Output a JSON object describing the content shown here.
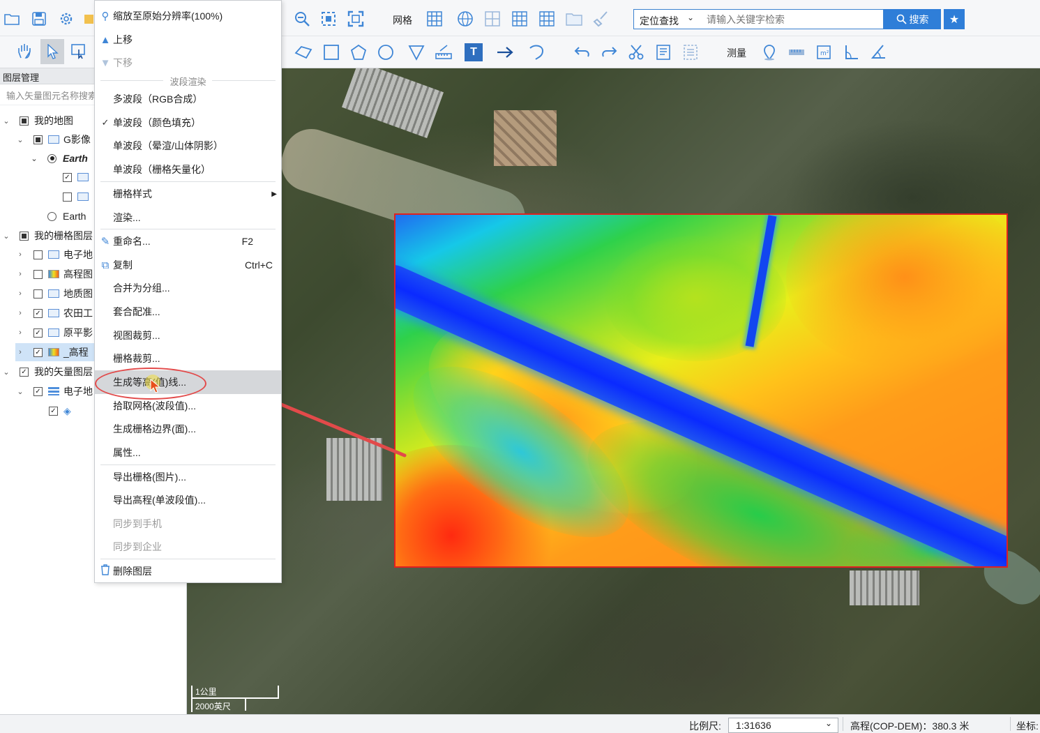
{
  "toolbar1": {
    "grid_label": "网格",
    "search_type": "定位查找",
    "search_placeholder": "请输入关键字检索",
    "search_button": "搜索"
  },
  "toolbar2": {
    "measure_label": "测量"
  },
  "left_panel": {
    "title": "图层管理",
    "search_placeholder": "输入矢量图元名称搜索",
    "tree": [
      {
        "label": "我的地图"
      },
      {
        "label": "G影像"
      },
      {
        "label": "Earth"
      },
      {
        "label": "Earth"
      },
      {
        "label": "我的栅格图层"
      },
      {
        "label": "电子地"
      },
      {
        "label": "高程图"
      },
      {
        "label": "地质图"
      },
      {
        "label": "农田工"
      },
      {
        "label": "原平影"
      },
      {
        "label": "_高程"
      },
      {
        "label": "我的矢量图层"
      },
      {
        "label": "电子地"
      }
    ]
  },
  "context_menu": {
    "items": [
      {
        "label": "缩放至原始分辨率(100%)",
        "shortcut": ""
      },
      {
        "label": "上移",
        "shortcut": ""
      },
      {
        "label": "下移",
        "shortcut": ""
      },
      {
        "label": "波段渲染",
        "shortcut": ""
      },
      {
        "label": "多波段（RGB合成）",
        "shortcut": ""
      },
      {
        "label": "单波段（颜色填充）",
        "shortcut": ""
      },
      {
        "label": "单波段（晕渲/山体阴影）",
        "shortcut": ""
      },
      {
        "label": "单波段（栅格矢量化）",
        "shortcut": ""
      },
      {
        "label": "栅格样式",
        "shortcut": ""
      },
      {
        "label": "渲染...",
        "shortcut": ""
      },
      {
        "label": "重命名...",
        "shortcut": "F2"
      },
      {
        "label": "复制",
        "shortcut": "Ctrl+C"
      },
      {
        "label": "合并为分组...",
        "shortcut": ""
      },
      {
        "label": "套合配准...",
        "shortcut": ""
      },
      {
        "label": "视图裁剪...",
        "shortcut": ""
      },
      {
        "label": "栅格裁剪...",
        "shortcut": ""
      },
      {
        "label": "生成等高(值)线...",
        "shortcut": ""
      },
      {
        "label": "拾取网格(波段值)...",
        "shortcut": ""
      },
      {
        "label": "生成栅格边界(面)...",
        "shortcut": ""
      },
      {
        "label": "属性...",
        "shortcut": ""
      },
      {
        "label": "导出栅格(图片)...",
        "shortcut": ""
      },
      {
        "label": "导出高程(单波段值)...",
        "shortcut": ""
      },
      {
        "label": "同步到手机",
        "shortcut": ""
      },
      {
        "label": "同步到企业",
        "shortcut": ""
      },
      {
        "label": "删除图层",
        "shortcut": ""
      }
    ]
  },
  "map": {
    "scale_bar_top": "1公里",
    "scale_bar_bottom": "2000英尺"
  },
  "status_bar": {
    "scale_label": "比例尺:",
    "scale_value": "1:31636",
    "elevation": "高程(COP-DEM)：380.3 米",
    "coords_label": "坐标:"
  },
  "colors": {
    "accent": "#2f7ed8",
    "annotation_red": "#e24a4a",
    "dem_border": "#e02020"
  }
}
